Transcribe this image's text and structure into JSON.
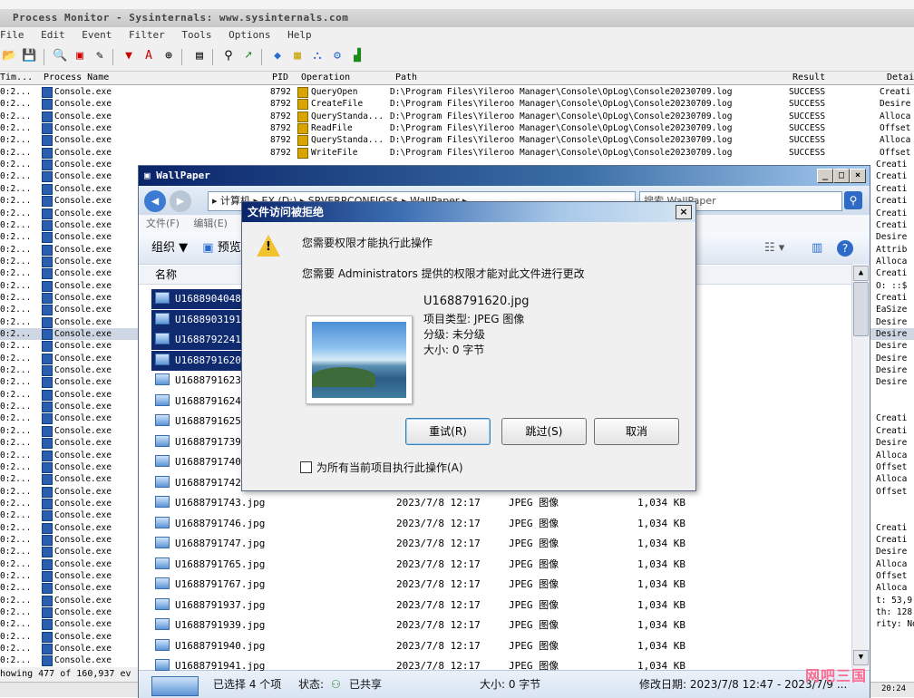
{
  "procmon": {
    "title": "Process Monitor - Sysinternals: www.sysinternals.com",
    "menu": [
      "File",
      "Edit",
      "Event",
      "Filter",
      "Tools",
      "Options",
      "Help"
    ],
    "columns": {
      "time": "Tim...",
      "process": "Process Name",
      "pid": "PID",
      "operation": "Operation",
      "path": "Path",
      "result": "Result",
      "detail": "Detai"
    },
    "rows_full": [
      {
        "time": "0:2...",
        "process": "Console.exe",
        "pid": "8792",
        "operation": "QueryOpen",
        "path": "D:\\Program Files\\Yileroo Manager\\Console\\OpLog\\Console20230709.log",
        "result": "SUCCESS",
        "detail": "Creati"
      },
      {
        "time": "0:2...",
        "process": "Console.exe",
        "pid": "8792",
        "operation": "CreateFile",
        "path": "D:\\Program Files\\Yileroo Manager\\Console\\OpLog\\Console20230709.log",
        "result": "SUCCESS",
        "detail": "Desire"
      },
      {
        "time": "0:2...",
        "process": "Console.exe",
        "pid": "8792",
        "operation": "QueryStanda...",
        "path": "D:\\Program Files\\Yileroo Manager\\Console\\OpLog\\Console20230709.log",
        "result": "SUCCESS",
        "detail": "Alloca"
      },
      {
        "time": "0:2...",
        "process": "Console.exe",
        "pid": "8792",
        "operation": "ReadFile",
        "path": "D:\\Program Files\\Yileroo Manager\\Console\\OpLog\\Console20230709.log",
        "result": "SUCCESS",
        "detail": "Offset"
      },
      {
        "time": "0:2...",
        "process": "Console.exe",
        "pid": "8792",
        "operation": "QueryStanda...",
        "path": "D:\\Program Files\\Yileroo Manager\\Console\\OpLog\\Console20230709.log",
        "result": "SUCCESS",
        "detail": "Alloca"
      },
      {
        "time": "0:2...",
        "process": "Console.exe",
        "pid": "8792",
        "operation": "WriteFile",
        "path": "D:\\Program Files\\Yileroo Manager\\Console\\OpLog\\Console20230709.log",
        "result": "SUCCESS",
        "detail": "Offset"
      }
    ],
    "row_time": "0:2...",
    "row_process": "Console.exe",
    "right_details": [
      "Creati",
      "Creati",
      "Creati",
      "Creati",
      "Creati",
      "Creati",
      "Desire",
      "Attrib",
      "Alloca",
      "Creati",
      "O: ::$",
      "Creati",
      "EaSize",
      "Desire",
      "Desire",
      "Desire",
      "Desire",
      "Desire",
      "Desire",
      "",
      "",
      "Creati",
      "Creati",
      "Desire",
      "Alloca",
      "Offset",
      "Alloca",
      "Offset",
      "",
      "",
      "Creati",
      "Creati",
      "Desire",
      "Alloca",
      "Offset",
      "Alloca",
      "t: 53,9",
      "th: 128",
      "rity: No"
    ],
    "status": "howing 477 of 160,937 ev",
    "clock": "20:24"
  },
  "explorer": {
    "title": "WallPaper",
    "address": "▸ 计算机 ▸ EX (D:) ▸ SRVERRCONFIGS$ ▸ WallPaper ▸",
    "search_placeholder": "搜索 WallPaper",
    "menu": [
      "文件(F)",
      "编辑(E)"
    ],
    "toolbar": {
      "organize": "组织 ▼",
      "preview": "预览"
    },
    "column_name": "名称",
    "files": [
      {
        "name": "U1688904048.",
        "date": "",
        "type": "",
        "size": "",
        "selected": true
      },
      {
        "name": "U1688903191.",
        "date": "",
        "type": "",
        "size": "",
        "selected": true
      },
      {
        "name": "U1688792241.",
        "date": "",
        "type": "",
        "size": "",
        "selected": true
      },
      {
        "name": "U1688791620.",
        "date": "",
        "type": "",
        "size": "",
        "selected": true
      },
      {
        "name": "U1688791623.",
        "date": "",
        "type": "",
        "size": "",
        "selected": false
      },
      {
        "name": "U1688791624.",
        "date": "",
        "type": "",
        "size": "",
        "selected": false
      },
      {
        "name": "U1688791625.",
        "date": "",
        "type": "",
        "size": "",
        "selected": false
      },
      {
        "name": "U1688791739.",
        "date": "",
        "type": "",
        "size": "",
        "selected": false
      },
      {
        "name": "U1688791740.",
        "date": "",
        "type": "",
        "size": "",
        "selected": false
      },
      {
        "name": "U1688791742.",
        "date": "",
        "type": "",
        "size": "",
        "selected": false
      },
      {
        "name": "U1688791743.jpg",
        "date": "2023/7/8 12:17",
        "type": "JPEG 图像",
        "size": "1,034 KB",
        "selected": false
      },
      {
        "name": "U1688791746.jpg",
        "date": "2023/7/8 12:17",
        "type": "JPEG 图像",
        "size": "1,034 KB",
        "selected": false
      },
      {
        "name": "U1688791747.jpg",
        "date": "2023/7/8 12:17",
        "type": "JPEG 图像",
        "size": "1,034 KB",
        "selected": false
      },
      {
        "name": "U1688791765.jpg",
        "date": "2023/7/8 12:17",
        "type": "JPEG 图像",
        "size": "1,034 KB",
        "selected": false
      },
      {
        "name": "U1688791767.jpg",
        "date": "2023/7/8 12:17",
        "type": "JPEG 图像",
        "size": "1,034 KB",
        "selected": false
      },
      {
        "name": "U1688791937.jpg",
        "date": "2023/7/8 12:17",
        "type": "JPEG 图像",
        "size": "1,034 KB",
        "selected": false
      },
      {
        "name": "U1688791939.jpg",
        "date": "2023/7/8 12:17",
        "type": "JPEG 图像",
        "size": "1,034 KB",
        "selected": false
      },
      {
        "name": "U1688791940.jpg",
        "date": "2023/7/8 12:17",
        "type": "JPEG 图像",
        "size": "1,034 KB",
        "selected": false
      },
      {
        "name": "U1688791941.jpg",
        "date": "2023/7/8 12:17",
        "type": "JPEG 图像",
        "size": "1,034 KB",
        "selected": false
      }
    ],
    "status": {
      "selected": "已选择 4 个项",
      "state_label": "状态:",
      "state_value": "已共享",
      "size": "大小: 0 字节",
      "modified": "修改日期: 2023/7/8 12:47 - 2023/7/9 ..."
    }
  },
  "dialog": {
    "title": "文件访问被拒绝",
    "message1": "您需要权限才能执行此操作",
    "message2": "您需要 Administrators 提供的权限才能对此文件进行更改",
    "filename": "U1688791620.jpg",
    "item_type": "项目类型: JPEG 图像",
    "rating": "分级: 未分级",
    "size": "大小: 0 字节",
    "btn_retry": "重试(R)",
    "btn_skip": "跳过(S)",
    "btn_cancel": "取消",
    "checkbox_label": "为所有当前项目执行此操作(A)"
  },
  "watermark": "网吧三国",
  "colors": {
    "selection": "#0f2a6f",
    "dialog_title": "#0a246a",
    "warning": "#f2c230"
  }
}
